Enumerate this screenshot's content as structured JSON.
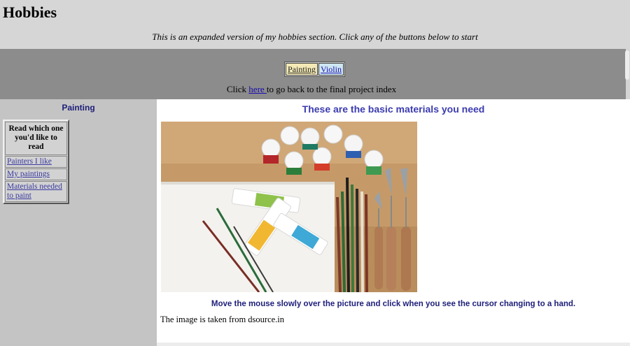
{
  "header": {
    "title": "Hobbies",
    "intro": "This is an expanded version of my hobbies section. Click any of the buttons below to start"
  },
  "nav": {
    "buttons": [
      "Painting",
      "Violin"
    ],
    "index_prefix": "Click ",
    "index_link": "here ",
    "index_suffix": "to go back to the final project index"
  },
  "sidebar": {
    "title": "Painting",
    "box_heading": "Read which one you'd like to read",
    "links": [
      "Painters I like",
      "My paintings",
      "Materials needed to paint"
    ]
  },
  "main": {
    "heading": "These are the basic materials you need",
    "caption": "Move the mouse slowly over the picture and click when you see the cursor changing to a hand.",
    "credit": "The image is taken from dsource.in"
  },
  "colors": {
    "header_bg": "#d6d6d6",
    "nav_bg": "#8c8c8c",
    "sidebar_bg": "#c4c4c4",
    "heading_blue": "#3b3bb0",
    "caption_navy": "#1e1e7a"
  }
}
